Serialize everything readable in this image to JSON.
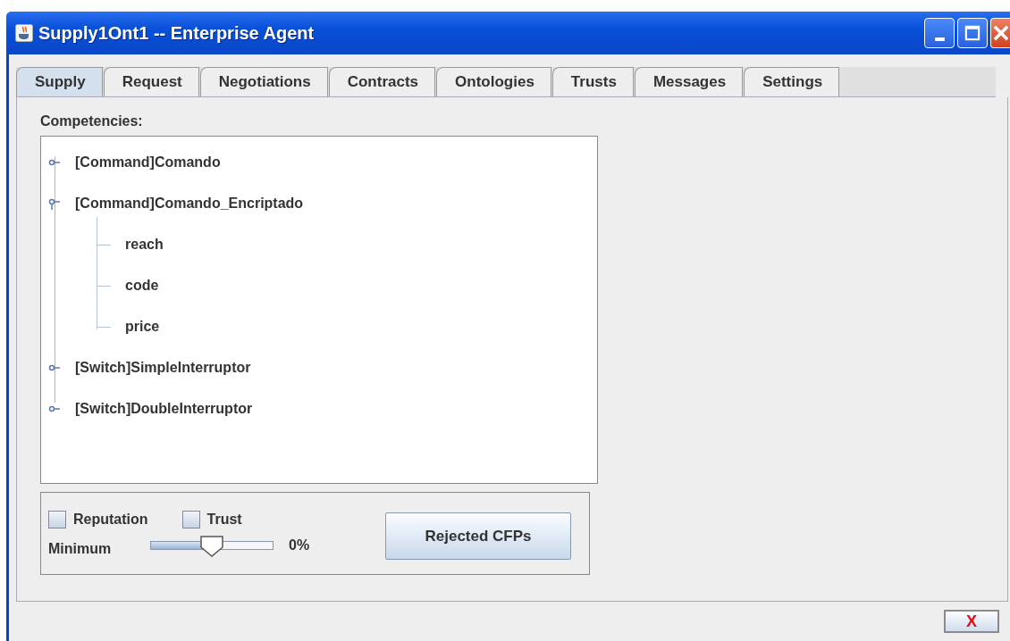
{
  "window": {
    "title": "Supply1Ont1 -- Enterprise Agent"
  },
  "tabs": [
    {
      "label": "Supply",
      "selected": true
    },
    {
      "label": "Request",
      "selected": false
    },
    {
      "label": "Negotiations",
      "selected": false
    },
    {
      "label": "Contracts",
      "selected": false
    },
    {
      "label": "Ontologies",
      "selected": false
    },
    {
      "label": "Trusts",
      "selected": false
    },
    {
      "label": "Messages",
      "selected": false
    },
    {
      "label": "Settings",
      "selected": false
    }
  ],
  "competencies": {
    "label": "Competencies:",
    "tree": [
      {
        "label": "[Command]Comando",
        "expanded": false
      },
      {
        "label": "[Command]Comando_Encriptado",
        "expanded": true,
        "children": [
          {
            "label": "reach"
          },
          {
            "label": "code"
          },
          {
            "label": "price"
          }
        ]
      },
      {
        "label": "[Switch]SimpleInterruptor",
        "expanded": false
      },
      {
        "label": "[Switch]DoubleInterruptor",
        "expanded": false
      }
    ]
  },
  "filters": {
    "checkboxes": [
      {
        "label": "Reputation",
        "checked": false
      },
      {
        "label": "Trust",
        "checked": false
      }
    ],
    "minimum": {
      "label": "Minimum",
      "level": 0.5,
      "reading": "0%"
    },
    "button": "Rejected CFPs"
  },
  "footer": {
    "close_button": "X"
  }
}
